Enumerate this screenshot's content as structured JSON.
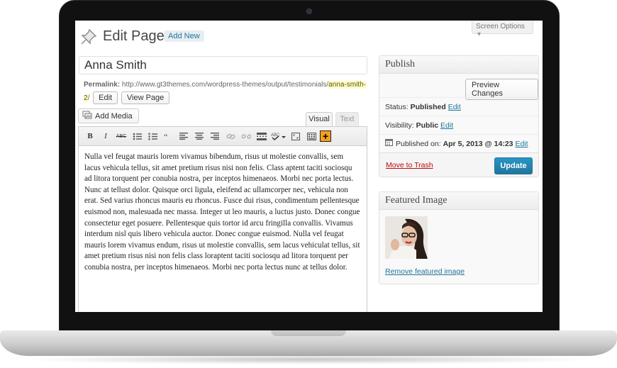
{
  "header": {
    "title": "Edit Page",
    "add_new": "Add New",
    "screen_options": "Screen Options"
  },
  "post": {
    "title": "Anna Smith",
    "permalink_label": "Permalink:",
    "permalink_base": "http://www.gt3themes.com/wordpress-themes/output/testimonials/",
    "permalink_slug": "anna-smith-2",
    "permalink_tail": "/",
    "edit_label": "Edit",
    "view_page_label": "View Page"
  },
  "editor": {
    "add_media": "Add Media",
    "tab_visual": "Visual",
    "tab_text": "Text",
    "toolbar": {
      "bold": "B",
      "italic": "I",
      "strike": "ABC"
    },
    "content": "Nulla vel feugat mauris lorem vivamus bibendum, risus ut molestie convallis, sem lacus vehicula tellus, sit amet pretium risus nisi non felis. Class aptent taciti sociosqu ad litora torquent per conubia nostra, per inceptos himenaeos. Morbi nec porta lectus. Nunc at tellust dolor. Quisque orci ligula, eleifend ac ullamcorper nec, vehicula non erat. Sed varius rhoncus mauris eu rhoncus. Fusce dui risus, condimentum pellentesque euismod non, malesuada nec massa. Integer ut leo mauris, a luctus justo. Donec congue consectetur eget posuere. Pellentesque quis tortor id arcu fringilla convallis. Vivamus interdum nisl quis libero vehicula auctor. Donec congue euismod. Nulla vel feugat mauris lorem vivamus endum, risus ut molestie convallis, sem lacus vehiculat tellus, sit amet pretium risus nisi non felis class loraptent taciti sociosqu ad litora torquent per conubia nostra, per inceptos himenaeos. Morbi nec porta lectus nunc at tellus dolor."
  },
  "publish": {
    "heading": "Publish",
    "preview_changes": "Preview Changes",
    "status_label": "Status:",
    "status_value": "Published",
    "visibility_label": "Visibility:",
    "visibility_value": "Public",
    "published_on_label": "Published on:",
    "published_on_value": "Apr 5, 2013 @ 14:23",
    "edit": "Edit",
    "move_to_trash": "Move to Trash",
    "update": "Update"
  },
  "featured": {
    "heading": "Featured Image",
    "remove": "Remove featured image"
  }
}
